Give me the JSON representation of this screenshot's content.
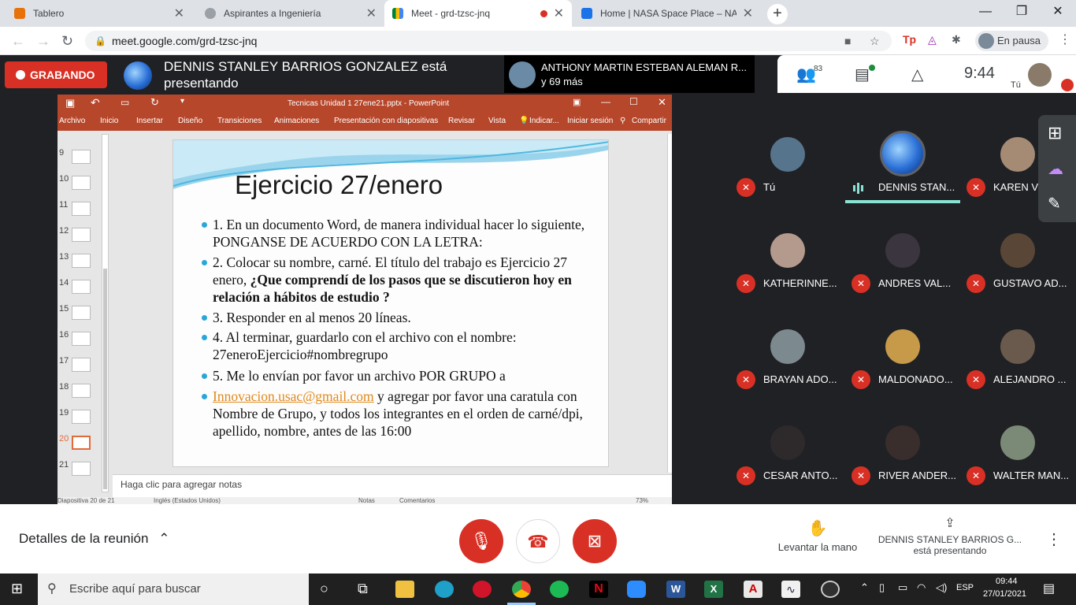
{
  "browser": {
    "tabs": [
      {
        "title": "Tablero",
        "active": false
      },
      {
        "title": "Aspirantes a Ingeniería",
        "active": false
      },
      {
        "title": "Meet - grd-tzsc-jnq",
        "active": true
      },
      {
        "title": "Home | NASA Space Place – NASA",
        "active": false
      }
    ],
    "url": "meet.google.com/grd-tzsc-jnq",
    "profile_status": "En pausa"
  },
  "meet_top": {
    "recording_label": "GRABANDO",
    "presenting_text": "DENNIS STANLEY BARRIOS GONZALEZ está presentando",
    "participant_chip_name": "ANTHONY MARTIN ESTEBAN ALEMAN R...",
    "participant_chip_more": "y 69 más",
    "people_count": "83",
    "clock": "9:44",
    "self_label": "Tú"
  },
  "powerpoint": {
    "title": "Tecnicas Unidad 1 27ene21.pptx - PowerPoint",
    "menu": [
      "Archivo",
      "Inicio",
      "Insertar",
      "Diseño",
      "Transiciones",
      "Animaciones",
      "Presentación con diapositivas",
      "Revisar",
      "Vista",
      "Indicar...",
      "Iniciar sesión",
      "Compartir"
    ],
    "thumb_numbers": [
      "9",
      "10",
      "11",
      "12",
      "13",
      "14",
      "15",
      "16",
      "17",
      "18",
      "19",
      "20",
      "21"
    ],
    "selected_slide": "20",
    "slide": {
      "title": "Ejercicio 27/enero",
      "bullets": [
        {
          "text": "1. En un documento Word, de manera individual hacer lo siguiente, PONGANSE DE ACUERDO CON LA LETRA:"
        },
        {
          "text_a": "2. Colocar su nombre, carné. El título del trabajo es Ejercicio 27 enero, ",
          "bold": "¿Que comprendí de los pasos que se discutieron hoy en relación a hábitos de estudio ?"
        },
        {
          "text": "3. Responder en al menos 20 líneas."
        },
        {
          "text": "4. Al terminar, guardarlo con el archivo con el nombre: 27eneroEjercicio#nombregrupo"
        },
        {
          "text": "5. Me lo envían por favor un archivo POR GRUPO a"
        },
        {
          "link": "Innovacion.usac@gmail.com",
          "text": " y agregar por favor una caratula con Nombre de Grupo, y todos los integrantes en el orden de carné/dpi, apellido, nombre, antes de las 16:00"
        }
      ]
    },
    "notes_placeholder": "Haga clic para agregar notas",
    "status": {
      "slide_count": "Diapositiva 20 de 21",
      "language": "Inglés (Estados Unidos)",
      "notes": "Notas",
      "comments": "Comentarios",
      "zoom": "73%"
    }
  },
  "participants": [
    {
      "name": "Tú",
      "muted": true
    },
    {
      "name": "DENNIS STAN...",
      "muted": false
    },
    {
      "name": "KAREN V...",
      "muted": true
    },
    {
      "name": "KATHERINNE...",
      "muted": true
    },
    {
      "name": "ANDRES VAL...",
      "muted": true
    },
    {
      "name": "GUSTAVO AD...",
      "muted": true
    },
    {
      "name": "BRAYAN ADO...",
      "muted": true
    },
    {
      "name": "MALDONADO...",
      "muted": true
    },
    {
      "name": "ALEJANDRO ...",
      "muted": true
    },
    {
      "name": "CESAR ANTO...",
      "muted": true
    },
    {
      "name": "RIVER ANDER...",
      "muted": true
    },
    {
      "name": "WALTER MAN...",
      "muted": true
    }
  ],
  "meet_bottom": {
    "details_label": "Detalles de la reunión",
    "raise_hand_label": "Levantar la mano",
    "presenter_name": "DENNIS STANLEY BARRIOS G...",
    "presenter_status": "está presentando"
  },
  "taskbar": {
    "search_placeholder": "Escribe aquí para buscar",
    "language": "ESP",
    "time": "09:44",
    "date": "27/01/2021"
  },
  "colors": {
    "ppt_accent": "#b7472a",
    "meet_red": "#d93025",
    "meet_dark": "#202124",
    "slide_bullet": "#2aa6d8",
    "link": "#e08a1e"
  }
}
